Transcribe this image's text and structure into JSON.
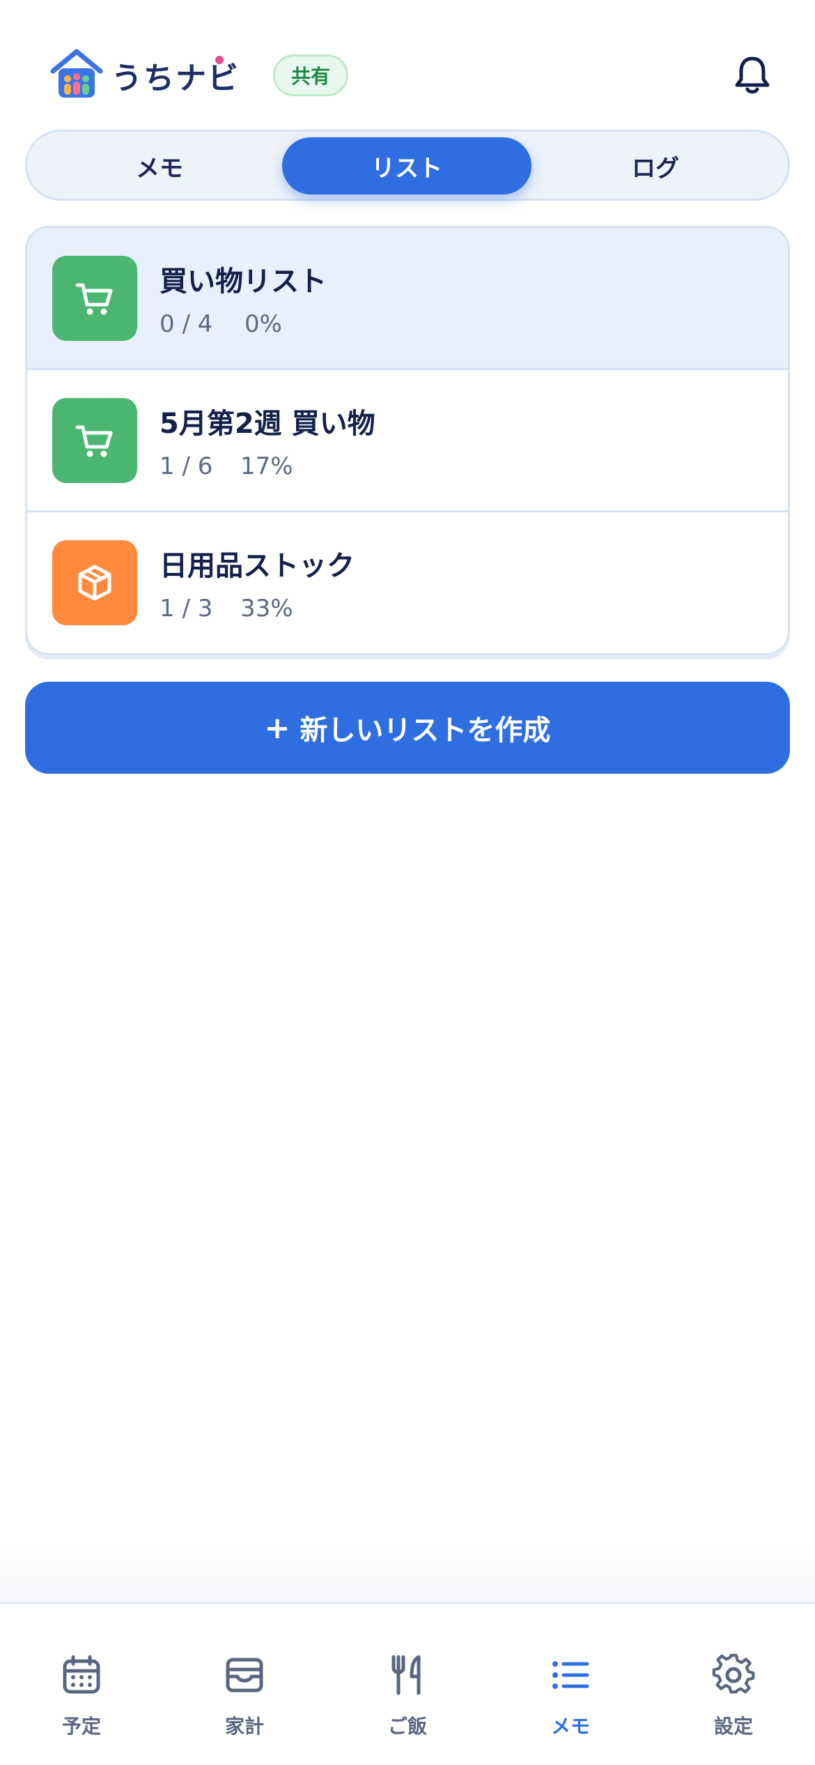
{
  "app": {
    "brand": "うちナビ",
    "shared_badge": "共有"
  },
  "tabs": [
    {
      "label": "メモ",
      "active": false
    },
    {
      "label": "リスト",
      "active": true
    },
    {
      "label": "ログ",
      "active": false
    }
  ],
  "lists": [
    {
      "title": "買い物リスト",
      "count": "0 / 4",
      "percent": "0%",
      "icon": "cart-icon",
      "color": "#4bb672",
      "selected": true
    },
    {
      "title": "5月第2週 買い物",
      "count": "1 / 6",
      "percent": "17%",
      "icon": "cart-icon",
      "color": "#4bb672",
      "selected": false
    },
    {
      "title": "日用品ストック",
      "count": "1 / 3",
      "percent": "33%",
      "icon": "box-icon",
      "color": "#ff8a3d",
      "selected": false
    }
  ],
  "create_button": {
    "plus": "+",
    "label": "新しいリストを作成"
  },
  "nav": [
    {
      "label": "予定",
      "icon": "calendar-icon",
      "active": false
    },
    {
      "label": "家計",
      "icon": "wallet-icon",
      "active": false
    },
    {
      "label": "ご飯",
      "icon": "utensils-icon",
      "active": false
    },
    {
      "label": "メモ",
      "icon": "list-icon",
      "active": true
    },
    {
      "label": "設定",
      "icon": "gear-icon",
      "active": false
    }
  ],
  "colors": {
    "accent": "#2f6ee0",
    "text_primary": "#12204a",
    "text_secondary": "#5e6a82",
    "selected_row": "#e8f0fd"
  }
}
